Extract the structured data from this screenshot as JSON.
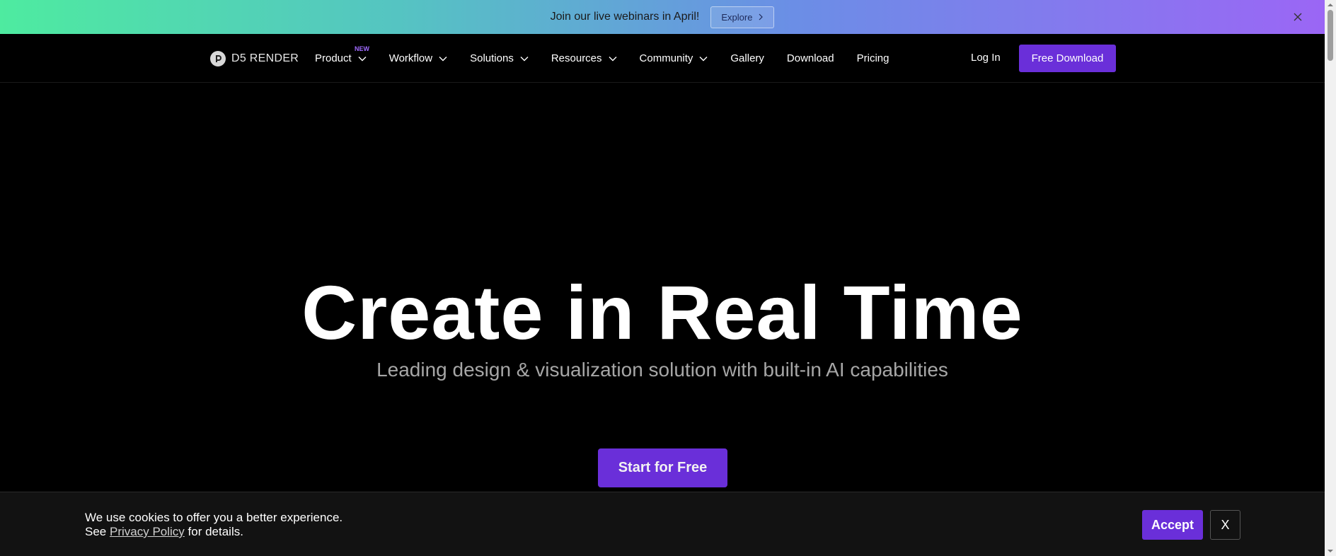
{
  "announcement": {
    "text": "Join our live webinars in April!",
    "button_label": "Explore"
  },
  "nav": {
    "logo_text": "D5 RENDER",
    "items": [
      {
        "label": "Product",
        "badge": "NEW",
        "dropdown": true
      },
      {
        "label": "Workflow",
        "dropdown": true
      },
      {
        "label": "Solutions",
        "dropdown": true
      },
      {
        "label": "Resources",
        "dropdown": true
      },
      {
        "label": "Community",
        "dropdown": true
      },
      {
        "label": "Gallery",
        "dropdown": false
      },
      {
        "label": "Download",
        "dropdown": false
      },
      {
        "label": "Pricing",
        "dropdown": false
      }
    ],
    "login_label": "Log In",
    "cta_label": "Free Download"
  },
  "hero": {
    "title": "Create in Real Time",
    "subtitle": "Leading design & visualization solution with built-in AI capabilities",
    "cta_label": "Start for Free"
  },
  "cookie": {
    "line1": "We use cookies to offer you a better experience.",
    "line2_prefix": "See",
    "link_label": "Privacy Policy",
    "line2_suffix": "for details.",
    "accept_label": "Accept",
    "close_label": "X"
  },
  "colors": {
    "accent": "#6a2fd9",
    "badge": "#a06bff",
    "background": "#000000",
    "gradient_start": "#4eeba0",
    "gradient_end": "#9b66f5"
  }
}
